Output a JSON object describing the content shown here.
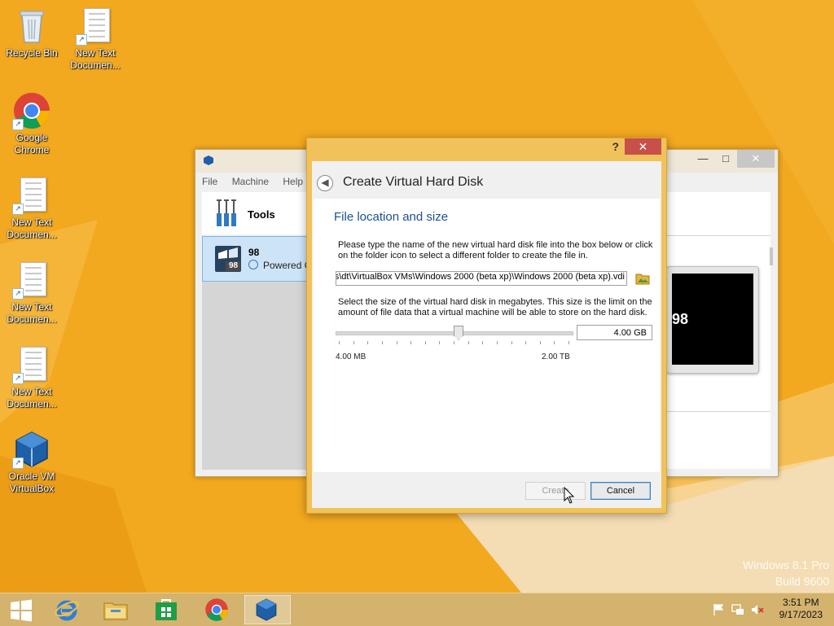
{
  "desktop": {
    "icons": [
      {
        "label": "Recycle Bin"
      },
      {
        "label": "New Text Documen..."
      },
      {
        "label": "Google Chrome"
      },
      {
        "label": "New Text Documen..."
      },
      {
        "label": "New Text Documen..."
      },
      {
        "label": "New Text Documen..."
      },
      {
        "label": "Oracle VM VirtualBox"
      }
    ],
    "watermark": {
      "line1": "Windows 8.1 Pro",
      "line2": "Build 9600"
    }
  },
  "vbox": {
    "menu": [
      "File",
      "Machine",
      "Help"
    ],
    "tools_label": "Tools",
    "vm": {
      "name": "98",
      "badge": "98",
      "state": "Powered O"
    },
    "preview_text": "98"
  },
  "dialog": {
    "help": "?",
    "close": "✕",
    "back": "◀",
    "title": "Create Virtual Hard Disk",
    "section_title": "File location and size",
    "instr_location": "Please type the name of the new virtual hard disk file into the box below or click on the folder icon to select a different folder to create the file in.",
    "path_value": "s\\dt\\VirtualBox VMs\\Windows 2000 (beta xp)\\Windows 2000 (beta xp).vdi",
    "instr_size": "Select the size of the virtual hard disk in megabytes. This size is the limit on the amount of file data that a virtual machine will be able to store on the hard disk.",
    "size_value": "4.00 GB",
    "slider_fraction": 0.52,
    "min_label": "4.00 MB",
    "max_label": "2.00 TB",
    "create_label": "Create",
    "cancel_label": "Cancel"
  },
  "taskbar": {
    "pinned": [
      "start-button",
      "internet-explorer-icon",
      "file-explorer-icon",
      "store-icon",
      "chrome-icon",
      "virtualbox-icon"
    ],
    "time": "3:51 PM",
    "date": "9/17/2023"
  },
  "colors": {
    "wallpaper": "#f1a51c",
    "dialog_frame": "#f2c25a",
    "accent_blue": "#1d4f91",
    "close_red": "#c7504a"
  }
}
